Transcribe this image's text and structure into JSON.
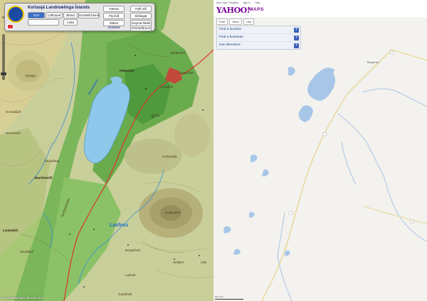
{
  "left": {
    "title": "Kortasjá Landmælinga Íslands",
    "buttons": {
      "kort": "Kort",
      "loftmynd": "Loftmynd",
      "blond": "Blönd",
      "umraedi": "Umræði blond",
      "farna": "Færna",
      "fylltvid": "Fyllt víð",
      "fly": "Fly leið",
      "skilingar": "Skilingar",
      "maera": "Mæra",
      "geyma": "Geyma hlekk",
      "leita": "Leita",
      "ommethruca": "Ommethruca"
    },
    "search_placeholder": "",
    "detail_label": "Detailed",
    "copyright": "© Landmælingar Íslands 2017",
    "place_labels": {
      "vikrafell": "Vikrafell",
      "dyngja": "Dyngja",
      "hrossafjall": "Hrossafjall",
      "hraunsbot": "Hraunsbót",
      "skardsheidi": "Skarðsheiði",
      "langalaug": "Langalaug",
      "skorradalur": "Skorradalur",
      "nordurarda": "Norðurárdalur",
      "laxfoss": "Laxfoss",
      "hafravatn": "Hafravatn",
      "brekkufell": "Brekkufell",
      "hreda": "Hreða",
      "laugarhals": "Laugarhals",
      "hallasafell": "Hallasafell",
      "borgarholt": "Borgarholt",
      "laxholt": "Laxholt",
      "gardsholt": "Garðsholt",
      "grjotholt": "Grjótholt",
      "hloltsel": "Hlöltsel",
      "lambafell": "Lambafell",
      "saudafell": "Sauðafell",
      "litla": "Litla",
      "hvitarsida": "Hvítarsíða"
    }
  },
  "right": {
    "top_links": [
      "New User? Register",
      "Sign In",
      "Help"
    ],
    "logo": "YAHOO!",
    "product": "MAPS",
    "toolbar": [
      "Print",
      "Send",
      "Link"
    ],
    "panel_rows": [
      "Find a location",
      "Find a business",
      "Get directions"
    ],
    "towns": [
      "Borgarnes"
    ],
    "scale_text": "1km   1mi"
  },
  "colors": {
    "topo_base": "#c9cf9a",
    "topo_green": "#7bb65a",
    "topo_dark_green": "#4f9a3c",
    "lake_blue": "#8ec8ea",
    "yahoo_water": "#a8c6e8",
    "yahoo_land": "#f3f2ee",
    "yahoo_purple": "#7b0099"
  }
}
